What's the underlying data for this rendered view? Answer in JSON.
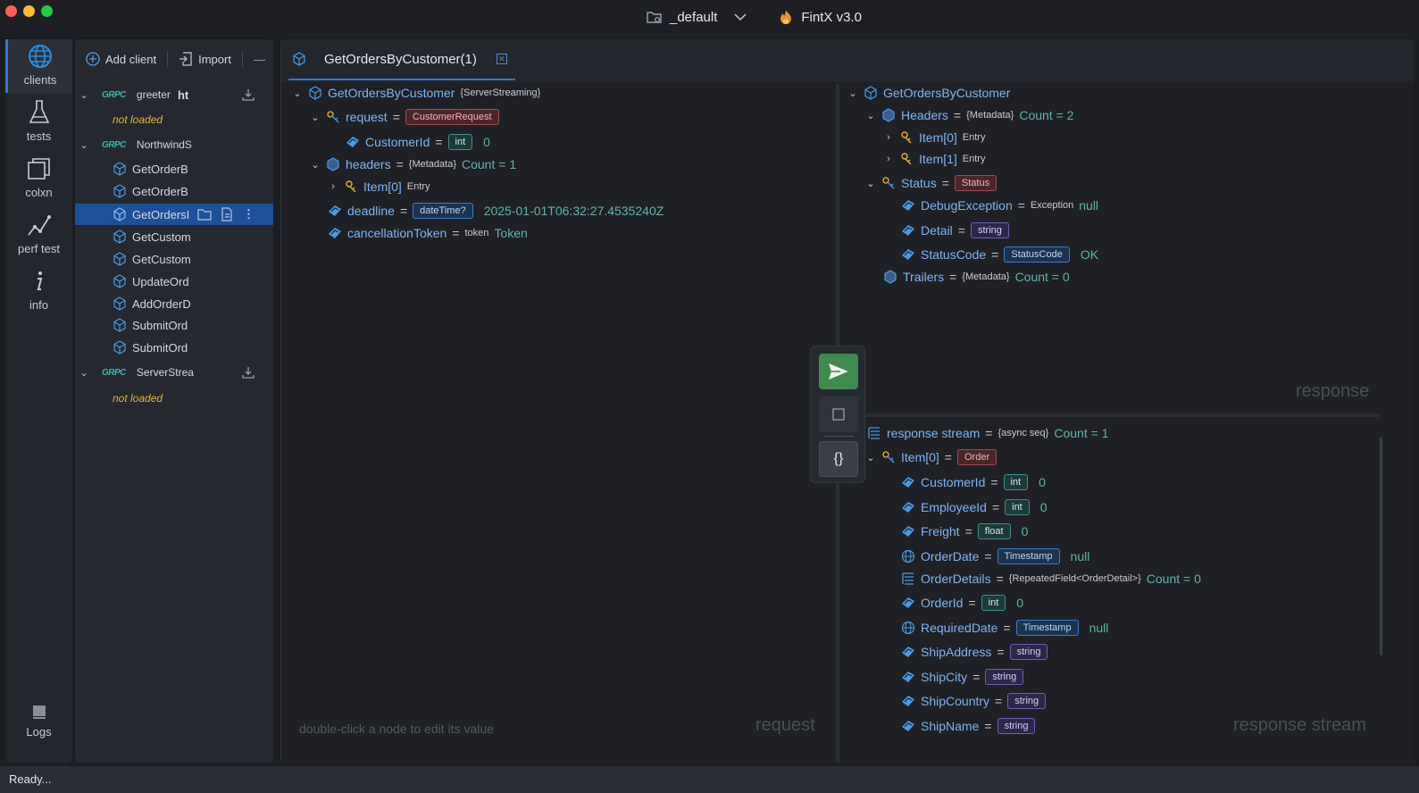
{
  "window": {
    "workspace": "_default",
    "app_name": "FintX v3.0"
  },
  "rail": {
    "items": [
      {
        "label": "clients"
      },
      {
        "label": "tests"
      },
      {
        "label": "colxn"
      },
      {
        "label": "perf test"
      },
      {
        "label": "info"
      }
    ],
    "logs_label": "Logs"
  },
  "tree_toolbar": {
    "add_client": "Add client",
    "import": "Import",
    "collapse": "—"
  },
  "tree": {
    "grpc_tag": "GRPC",
    "client1": {
      "name": "greeter",
      "suffix": "ht",
      "status": "not loaded"
    },
    "client2": {
      "name": "NorthwindS"
    },
    "methods": [
      "GetOrderB",
      "GetOrderB",
      "GetOrdersI",
      "GetCustom",
      "GetCustom",
      "UpdateOrd",
      "AddOrderD",
      "SubmitOrd",
      "SubmitOrd"
    ],
    "client3": {
      "name": "ServerStrea",
      "status": "not loaded"
    }
  },
  "tab": {
    "title": "GetOrdersByCustomer(1)",
    "close": "✕"
  },
  "request": {
    "root": {
      "name": "GetOrdersByCustomer",
      "type": "{ServerStreaming}"
    },
    "request_node": {
      "name": "request",
      "eq": "=",
      "badge": "CustomerRequest"
    },
    "customer_id": {
      "name": "CustomerId",
      "eq": "=",
      "badge": "int",
      "value": "0"
    },
    "headers": {
      "name": "headers",
      "eq": "=",
      "type": "{Metadata}",
      "count": "Count = 1"
    },
    "item0": {
      "name": "Item[0]",
      "type": "Entry"
    },
    "deadline": {
      "name": "deadline",
      "eq": "=",
      "badge": "dateTime?",
      "value": "2025-01-01T06:32:27.4535240Z"
    },
    "cancel": {
      "name": "cancellationToken",
      "eq": "=",
      "type": "token",
      "value": "Token"
    },
    "hint": "double-click a node to edit its value",
    "watermark": "request"
  },
  "response": {
    "root": {
      "name": "GetOrdersByCustomer"
    },
    "headers": {
      "name": "Headers",
      "eq": "=",
      "type": "{Metadata}",
      "count": "Count = 2"
    },
    "item0": {
      "name": "Item[0]",
      "type": "Entry"
    },
    "item1": {
      "name": "Item[1]",
      "type": "Entry"
    },
    "status": {
      "name": "Status",
      "eq": "=",
      "badge": "Status"
    },
    "debug": {
      "name": "DebugException",
      "eq": "=",
      "type": "Exception",
      "value": "null"
    },
    "detail": {
      "name": "Detail",
      "eq": "=",
      "badge": "string"
    },
    "statuscode": {
      "name": "StatusCode",
      "eq": "=",
      "badge": "StatusCode",
      "value": "OK"
    },
    "trailers": {
      "name": "Trailers",
      "eq": "=",
      "type": "{Metadata}",
      "count": "Count = 0"
    },
    "watermark": "response"
  },
  "stream": {
    "root": {
      "name": "response stream",
      "eq": "=",
      "type": "{async seq}",
      "count": "Count = 1"
    },
    "item0": {
      "name": "Item[0]",
      "eq": "=",
      "badge": "Order"
    },
    "fields": [
      {
        "name": "CustomerId",
        "eq": "=",
        "badge": "int",
        "value": "0"
      },
      {
        "name": "EmployeeId",
        "eq": "=",
        "badge": "int",
        "value": "0"
      },
      {
        "name": "Freight",
        "eq": "=",
        "badge": "float",
        "value": "0"
      },
      {
        "name": "OrderDate",
        "eq": "=",
        "badge": "Timestamp",
        "value": "null"
      },
      {
        "name": "OrderDetails",
        "eq": "=",
        "type": "{RepeatedField<OrderDetail>}",
        "value": "Count = 0"
      },
      {
        "name": "OrderId",
        "eq": "=",
        "badge": "int",
        "value": "0"
      },
      {
        "name": "RequiredDate",
        "eq": "=",
        "badge": "Timestamp",
        "value": "null"
      },
      {
        "name": "ShipAddress",
        "eq": "=",
        "badge": "string",
        "value": ""
      },
      {
        "name": "ShipCity",
        "eq": "=",
        "badge": "string",
        "value": ""
      },
      {
        "name": "ShipCountry",
        "eq": "=",
        "badge": "string",
        "value": ""
      },
      {
        "name": "ShipName",
        "eq": "=",
        "badge": "string",
        "value": ""
      }
    ],
    "watermark": "response stream"
  },
  "actions": {
    "json": "{}"
  },
  "status": {
    "text": "Ready..."
  }
}
